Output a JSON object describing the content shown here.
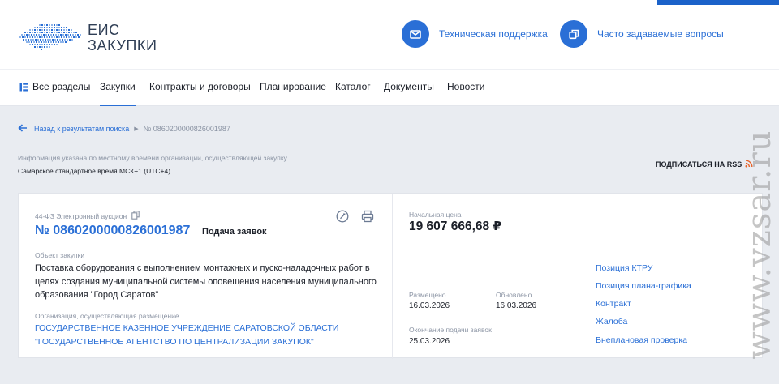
{
  "header": {
    "logo_line1": "ЕИС",
    "logo_line2": "ЗАКУПКИ",
    "support_label": "Техническая поддержка",
    "faq_label": "Часто задаваемые вопросы",
    "support_icon": "mail-icon",
    "faq_icon": "copy-icon"
  },
  "nav": {
    "items": [
      "Все разделы",
      "Закупки",
      "Контракты и договоры",
      "Планирование",
      "Каталог",
      "Документы",
      "Новости"
    ],
    "active": "Закупки"
  },
  "breadcrumb": {
    "back_label": "Назад к результатам поиска",
    "current": "№ 0860200000826001987"
  },
  "info": {
    "note": "Информация указана по местному времени организации, осуществляющей закупку",
    "timezone": "Самарское стандартное время МСК+1 (UTC+4)",
    "rss_label": "ПОДПИСАТЬСЯ НА RSS"
  },
  "card": {
    "law_type": "44-ФЗ Электронный аукцион",
    "reg_number": "№ 0860200000826001987",
    "stage": "Подача заявок",
    "subject_label": "Объект закупки",
    "subject": "Поставка оборудования с выполнением монтажных и пуско-наладочных работ в целях создания муниципальной системы оповещения населения муниципального образования \"Город Саратов\"",
    "org_label": "Организация, осуществляющая размещение",
    "org_line1": "ГОСУДАРСТВЕННОЕ КАЗЕННОЕ УЧРЕЖДЕНИЕ САРАТОВСКОЙ ОБЛАСТИ",
    "org_line2": "\"ГОСУДАРСТВЕННОЕ АГЕНТСТВО ПО ЦЕНТРАЛИЗАЦИИ ЗАКУПОК\"",
    "price_label": "Начальная цена",
    "price": "19 607 666,68 ₽",
    "posted_label": "Размещено",
    "posted": "16.03.2026",
    "updated_label": "Обновлено",
    "updated": "16.03.2026",
    "deadline_label": "Окончание подачи заявок",
    "deadline": "25.03.2026",
    "links": [
      "Позиция КТРУ",
      "Позиция плана-графика",
      "Контракт",
      "Жалоба",
      "Внеплановая проверка"
    ]
  },
  "watermark": "www.vzsar.ru",
  "colors": {
    "accent": "#2a6fd6",
    "page_bg": "#e9ecf1"
  }
}
